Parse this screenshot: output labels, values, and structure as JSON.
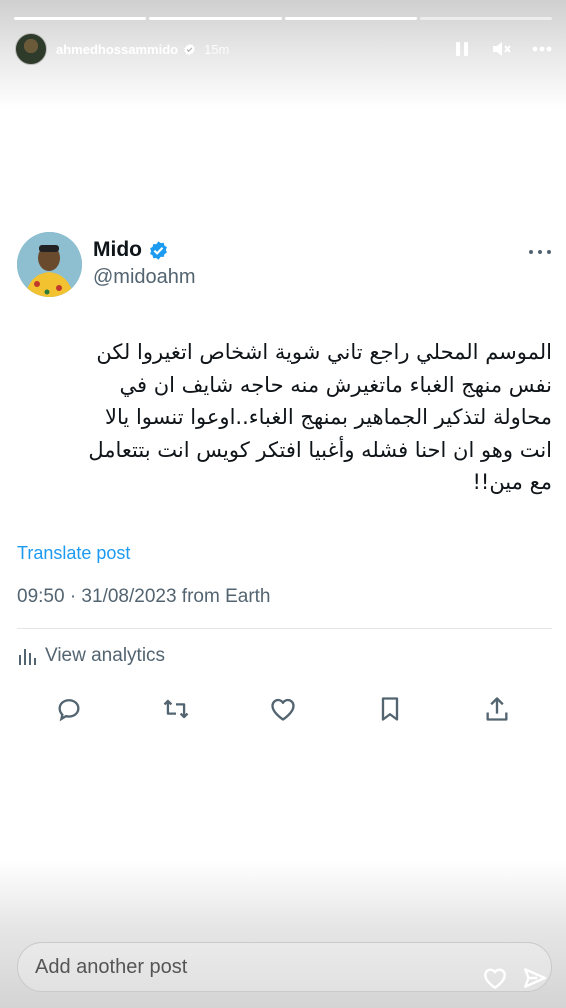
{
  "story": {
    "progress_segments": [
      {
        "state": "done"
      },
      {
        "state": "done"
      },
      {
        "state": "done"
      },
      {
        "state": "current"
      }
    ],
    "username": "ahmedhossammido",
    "time": "15m",
    "controls": [
      "pause-icon",
      "mute-icon",
      "more-icon"
    ]
  },
  "tweet": {
    "display_name": "Mido",
    "handle": "@midoahm",
    "verified": true,
    "text_lines": [
      "الموسم المحلي راجع تاني شوية اشخاص اتغيروا لكن",
      "نفس منهج الغباء ماتغيرش منه حاجه شايف ان في",
      "محاولة لتذكير الجماهير بمنهج الغباء..اوعوا تنسوا يالا",
      "انت وهو ان احنا فشله وأغبيا افتكر كويس انت بتتعامل",
      "مع مين!!"
    ],
    "translate_label": "Translate post",
    "timestamp": "09:50 · 31/08/2023 from Earth",
    "analytics_label": "View analytics",
    "actions": [
      "reply-icon",
      "retweet-icon",
      "like-icon",
      "bookmark-icon",
      "share-icon"
    ]
  },
  "reply": {
    "placeholder": "Add another post"
  },
  "colors": {
    "accent": "#1d9bf0",
    "text": "#0f1419",
    "muted": "#536471"
  }
}
